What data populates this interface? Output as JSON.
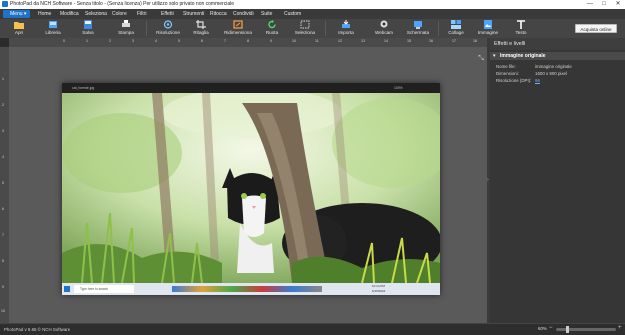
{
  "window": {
    "title": "PhotoPad da NCH Software - Senza titolo - (Senza licenza) Per utilizzo solo privato non commerciale",
    "controls": [
      "—",
      "□",
      "✕"
    ]
  },
  "menubar": {
    "menu_label": "Menu ▾",
    "items": [
      "Home",
      "Modifica",
      "Seleziona",
      "Colore",
      "Filtri",
      "Effetti",
      "Strumenti",
      "Ritocca",
      "Condividi",
      "Suite",
      "Custom"
    ]
  },
  "toolbar": {
    "tools": [
      {
        "label": "Apri",
        "icon": "folder-icon",
        "color": "#f2c14e"
      },
      {
        "label": "Libreria",
        "icon": "library-icon",
        "color": "#4da3ff"
      },
      {
        "label": "Salva",
        "icon": "save-icon",
        "color": "#3d8bd8"
      },
      {
        "label": "Stampa",
        "icon": "print-icon",
        "color": "#d9d9d9"
      },
      {
        "label": "Risoluzione",
        "icon": "resolution-icon",
        "color": "#7ec8ff"
      },
      {
        "label": "Ritaglia",
        "icon": "crop-icon",
        "color": "#e0e0e0"
      },
      {
        "label": "Ridimensiona",
        "icon": "resize-icon",
        "color": "#ff9f43"
      },
      {
        "label": "Ruota",
        "icon": "rotate-icon",
        "color": "#4cd964"
      },
      {
        "label": "Seleziona",
        "icon": "select-icon",
        "color": "#e0e0e0"
      },
      {
        "label": "Importa",
        "icon": "import-icon",
        "color": "#4da3ff"
      },
      {
        "label": "Webcam",
        "icon": "webcam-icon",
        "color": "#e0e0e0"
      },
      {
        "label": "Schermata",
        "icon": "screenshot-icon",
        "color": "#4da3ff"
      },
      {
        "label": "Collage",
        "icon": "collage-icon",
        "color": "#7ec8ff"
      },
      {
        "label": "Immagine",
        "icon": "image-icon",
        "color": "#4da3ff"
      },
      {
        "label": "Testo",
        "icon": "text-icon",
        "color": "#ffffff"
      }
    ],
    "upgrade_label": "Acquista online"
  },
  "ruler": {
    "h_ticks": [
      "0",
      "1",
      "2",
      "3",
      "4",
      "5",
      "6",
      "7",
      "8",
      "9",
      "10",
      "11",
      "12",
      "13",
      "14",
      "15",
      "16",
      "17",
      "18"
    ],
    "v_ticks": [
      "1",
      "2",
      "3",
      "4",
      "5",
      "6",
      "7",
      "8",
      "9",
      "10"
    ]
  },
  "panel": {
    "title": "Effetti e livelli",
    "layer_name": "Immagine originale",
    "props": [
      {
        "k": "Nome file:",
        "v": "immagine originale"
      },
      {
        "k": "Dimensioni:",
        "v": "1600 x 900 pixel"
      },
      {
        "k": "Risoluzione (DPI):",
        "v": "96"
      }
    ]
  },
  "image": {
    "inner_window_title": "cat_foreste.jpg",
    "inner_zoom": "100%",
    "taskbar_search": "Type here to search",
    "taskbar_time": "10:14 PM",
    "taskbar_date": "6/15/2024"
  },
  "status": {
    "text": "PhotoPad v 9.65 © NCH Software",
    "zoom": "60%"
  },
  "colors": {
    "accent": "#1e73c8",
    "panel": "#363636",
    "canvas": "#5a5a5a"
  }
}
